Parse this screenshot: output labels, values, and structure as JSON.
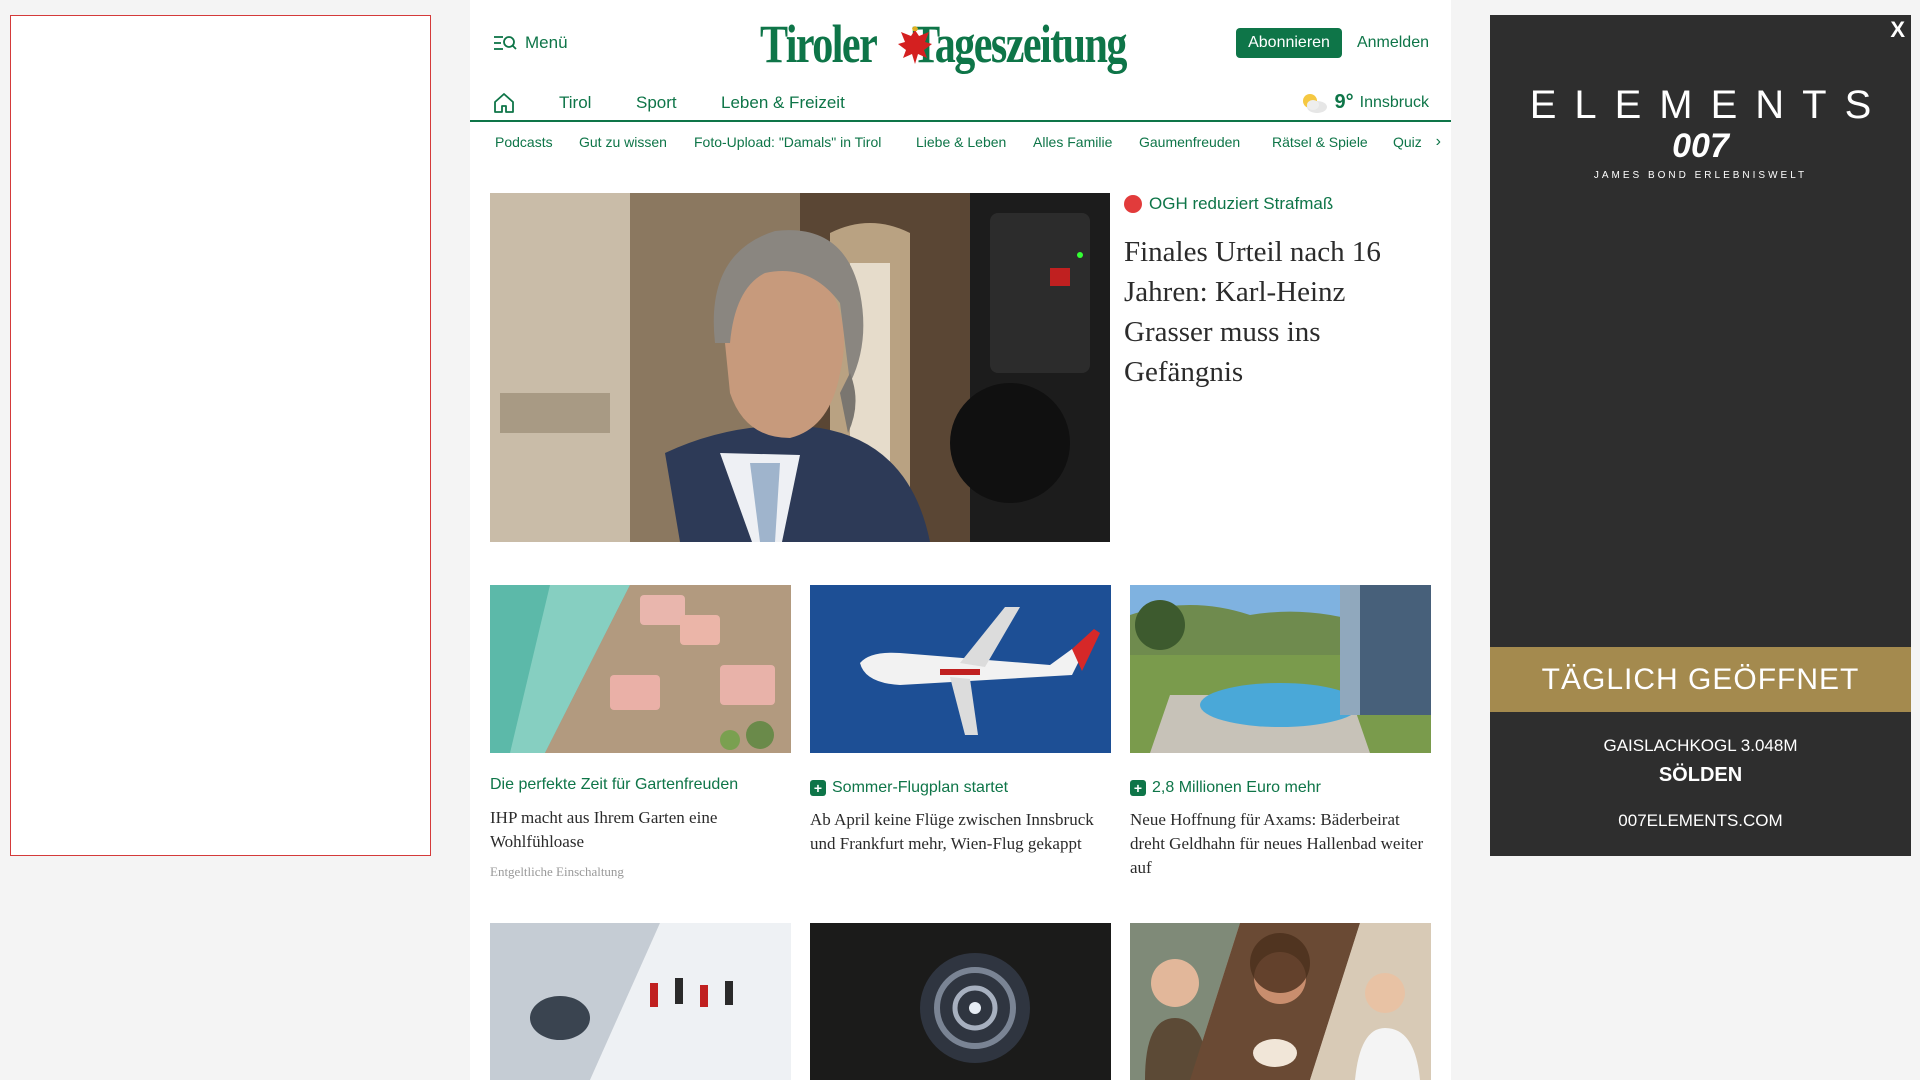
{
  "header": {
    "menu_label": "Menü",
    "logo_text_left": "Tiroler",
    "logo_text_right": "Tageszeitung",
    "subscribe_label": "Abonnieren",
    "login_label": "Anmelden"
  },
  "nav": {
    "items": [
      {
        "label": "Tirol"
      },
      {
        "label": "Sport"
      },
      {
        "label": "Leben & Freizeit"
      }
    ],
    "weather": {
      "temp": "9°",
      "city": "Innsbruck"
    }
  },
  "subnav": {
    "items": [
      {
        "label": "Podcasts"
      },
      {
        "label": "Gut zu wissen"
      },
      {
        "label": "Foto-Upload: \"Damals\" in Tirol"
      },
      {
        "label": "Liebe & Leben"
      },
      {
        "label": "Alles Familie"
      },
      {
        "label": "Gaumenfreuden"
      },
      {
        "label": "Rätsel & Spiele"
      },
      {
        "label": "Quiz"
      }
    ]
  },
  "hero": {
    "kicker": "OGH reduziert Strafmaß",
    "title": "Finales Urteil nach 16 Jahren: Karl-Heinz Grasser muss ins Gefängnis"
  },
  "cards": [
    {
      "kicker": "Die perfekte Zeit für Gartenfreuden",
      "title": "IHP macht aus Ihrem Garten eine Wohlfühloase",
      "note": "Entgeltliche Einschaltung"
    },
    {
      "kicker": "Sommer-Flugplan startet",
      "title": "Ab April keine Flüge zwischen Innsbruck und Frankfurt mehr, Wien-Flug gekappt"
    },
    {
      "kicker": "2,8 Millionen Euro mehr",
      "title": "Neue Hoffnung für Axams: Bäderbeirat dreht Geldhahn für neues Hallenbad weiter auf"
    }
  ],
  "ad": {
    "close": "X",
    "brand": "ELEMENTS",
    "brand_007": "007",
    "sub": "JAMES BOND ERLEBNISWELT",
    "band": "TÄGLICH GEÖFFNET",
    "peak": "GAISLACHKOGL 3.048M",
    "place": "SÖLDEN",
    "url": "007ELEMENTS.COM"
  },
  "colors": {
    "brand_green": "#0e7548",
    "ad_gold": "#a48a4e",
    "ad_bg": "#2e2e2e",
    "live_red": "#e23b3b"
  }
}
